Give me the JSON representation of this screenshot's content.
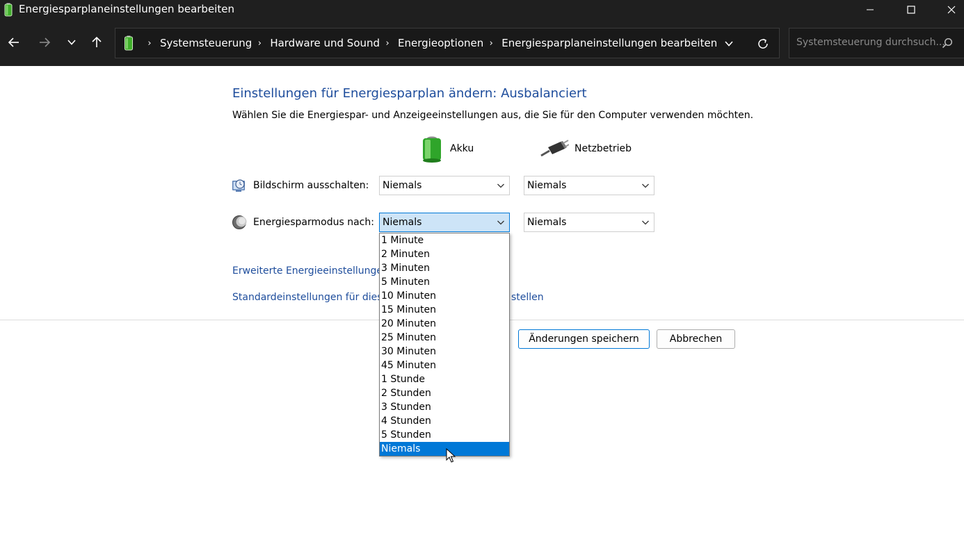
{
  "window": {
    "title": "Energiesparplaneinstellungen bearbeiten"
  },
  "address": {
    "breadcrumbs": [
      "Systemsteuerung",
      "Hardware und Sound",
      "Energieoptionen",
      "Energiesparplaneinstellungen bearbeiten"
    ]
  },
  "search": {
    "placeholder": "Systemsteuerung durchsuch..."
  },
  "content": {
    "title": "Einstellungen für Energiesparplan ändern: Ausbalanciert",
    "description": "Wählen Sie die Energiespar- und Anzeigeeinstellungen aus, die Sie für den Computer verwenden möchten.",
    "columns": {
      "battery": "Akku",
      "plugged": "Netzbetrieb"
    },
    "rows": {
      "display": {
        "label": "Bildschirm ausschalten:",
        "battery_value": "Niemals",
        "plugged_value": "Niemals"
      },
      "sleep": {
        "label": "Energiesparmodus nach:",
        "battery_value": "Niemals",
        "plugged_value": "Niemals"
      }
    },
    "links": {
      "advanced": "Erweiterte Energieeinstellungen",
      "restore_start": "Standardeinstellungen für diese",
      "restore_end": "stellen"
    },
    "buttons": {
      "save": "Änderungen speichern",
      "cancel": "Abbrechen"
    }
  },
  "dropdown": {
    "options": [
      "1 Minute",
      "2 Minuten",
      "3 Minuten",
      "5 Minuten",
      "10 Minuten",
      "15 Minuten",
      "20 Minuten",
      "25 Minuten",
      "30 Minuten",
      "45 Minuten",
      "1 Stunde",
      "2 Stunden",
      "3 Stunden",
      "4 Stunden",
      "5 Stunden",
      "Niemals"
    ],
    "selected": "Niemals"
  },
  "colors": {
    "chrome": "#1f1f1f",
    "title_blue": "#1e4d9c",
    "selection": "#0078d7",
    "active_select": "#cde4f7"
  },
  "icons": {
    "title": "battery-icon",
    "back": "arrow-left-icon",
    "forward": "arrow-right-icon",
    "recent": "chevron-down-icon",
    "up": "arrow-up-icon",
    "refresh": "refresh-icon",
    "search": "search-icon",
    "battery_column": "battery-icon",
    "plug_column": "power-plug-icon",
    "display_row": "monitor-clock-icon",
    "sleep_row": "moon-icon"
  }
}
